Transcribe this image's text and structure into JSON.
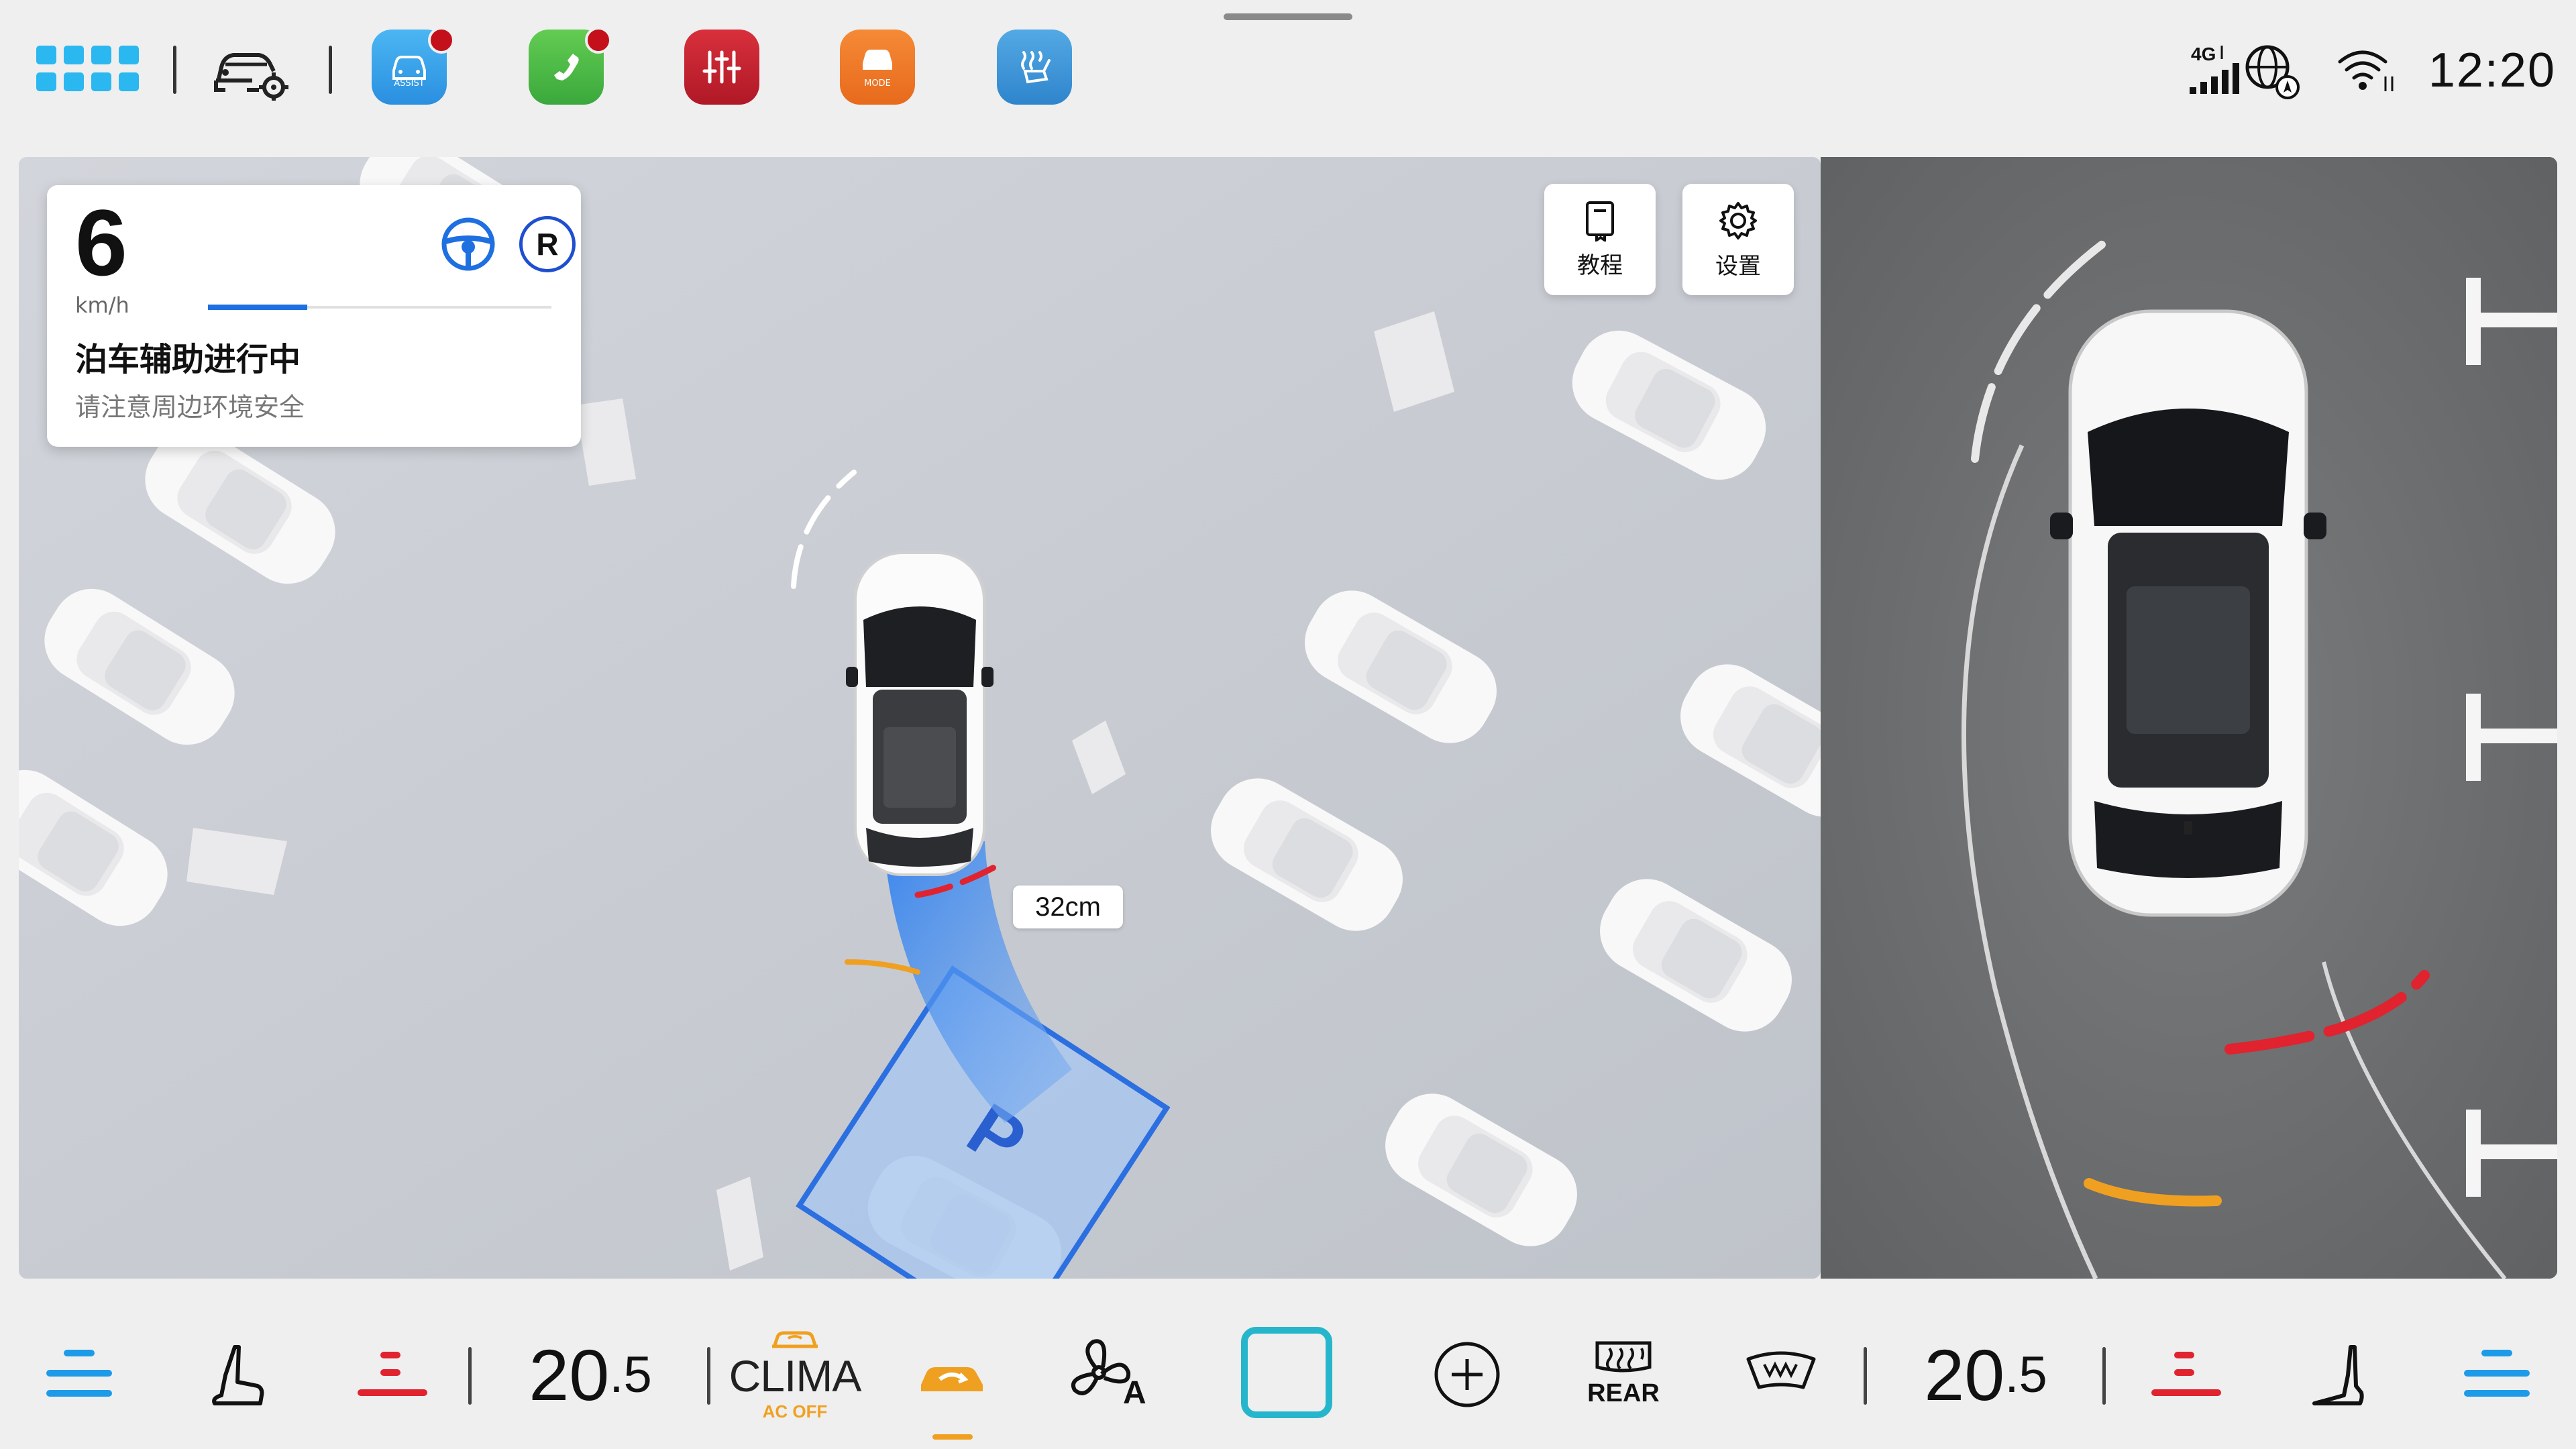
{
  "topbar": {
    "clock": "12:20",
    "network": "4G",
    "apps": [
      {
        "name": "assist",
        "label": "ASSIST",
        "color": "#2fa4e8",
        "badge": true
      },
      {
        "name": "phone",
        "label": "",
        "color": "#3fb44a",
        "badge": true
      },
      {
        "name": "equalizer",
        "label": "",
        "color": "#c81e2c",
        "badge": false
      },
      {
        "name": "mode",
        "label": "MODE",
        "color": "#f07a28",
        "badge": false
      },
      {
        "name": "seat-heat",
        "label": "",
        "color": "#3a8fd4",
        "badge": false
      }
    ]
  },
  "parking": {
    "speed": "6",
    "speed_unit": "km/h",
    "progress": 0.29,
    "title": "泊车辅助进行中",
    "subtitle": "请注意周边环境安全",
    "gear": "R",
    "distance": "32cm",
    "slot_mark": "P",
    "tutorial_label": "教程",
    "settings_label": "设置"
  },
  "climate": {
    "left_temp_main": "20",
    "left_temp_dec": ".5",
    "right_temp_main": "20",
    "right_temp_dec": ".5",
    "clima_label": "CLIMA",
    "ac_status": "AC OFF",
    "rear_label": "REAR",
    "accent_blue": "#1e9be8",
    "accent_red": "#e0232e",
    "accent_orange": "#f0a020"
  }
}
